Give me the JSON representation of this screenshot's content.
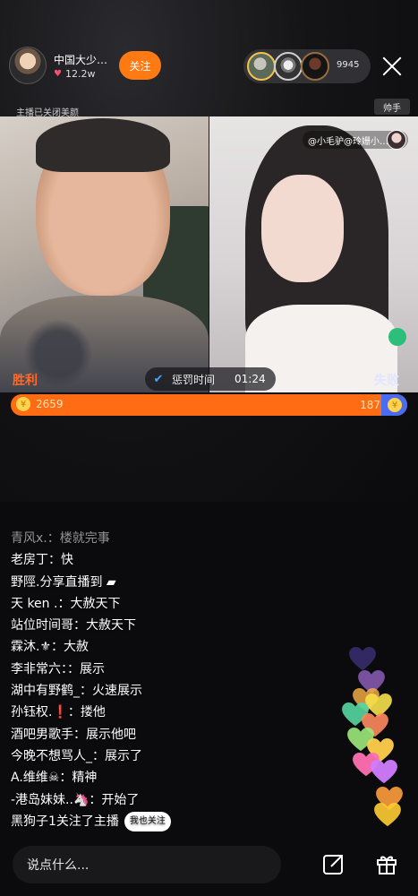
{
  "header": {
    "host_name": "中国大少…",
    "likes": "12.2w",
    "follow_label": "关注",
    "viewer_count": "9945",
    "beauty_note": "主播已关闭美颜",
    "anchor_tag": "帅手"
  },
  "pk": {
    "guest_tag": "@小毛驴@玲姗小…",
    "win_label": "胜利",
    "lose_label": "失败",
    "punish_label": "惩罚时间",
    "punish_time": "01:24",
    "score_left": "2659",
    "score_right": "187",
    "score_right_fraction": 0.066
  },
  "chat": [
    {
      "user": "青风x.",
      "text": "：楼就完事"
    },
    {
      "user": "老房丁",
      "text": "：快"
    },
    {
      "user": "野陘.",
      "text": "分享直播到 ▰"
    },
    {
      "user": "天 ken .",
      "text": "：大赦天下"
    },
    {
      "user": "站位时间哥",
      "text": "：大赦天下"
    },
    {
      "user": "霖沐.⚜",
      "text": "：大赦"
    },
    {
      "user": "李非常六",
      "text": "：：展示"
    },
    {
      "user": "湖中有野鹤_",
      "text": "：火速展示"
    },
    {
      "user": "孙钰权.❗",
      "text": "：搂他"
    },
    {
      "user": "酒吧男歌手",
      "text": "：展示他吧"
    },
    {
      "user": "今晚不想骂人_",
      "text": "：展示了"
    },
    {
      "user": "A.维维☠",
      "text": "：精神"
    },
    {
      "user": "-港岛妹妹..🦄",
      "text": "：开始了"
    },
    {
      "user": "黑狗子1",
      "text": "关注了主播"
    }
  ],
  "follow_chip": "我也关注",
  "bottom": {
    "input_placeholder": "说点什么..."
  },
  "icons": [
    "close-icon",
    "heart-icon",
    "share-icon",
    "gift-icon",
    "coin-icon",
    "pk-icon"
  ],
  "colors": {
    "follow": "#ff7a12",
    "win": "#ff6a2a",
    "score_orange": "#ff6c14",
    "score_blue": "#4a6cf0"
  }
}
